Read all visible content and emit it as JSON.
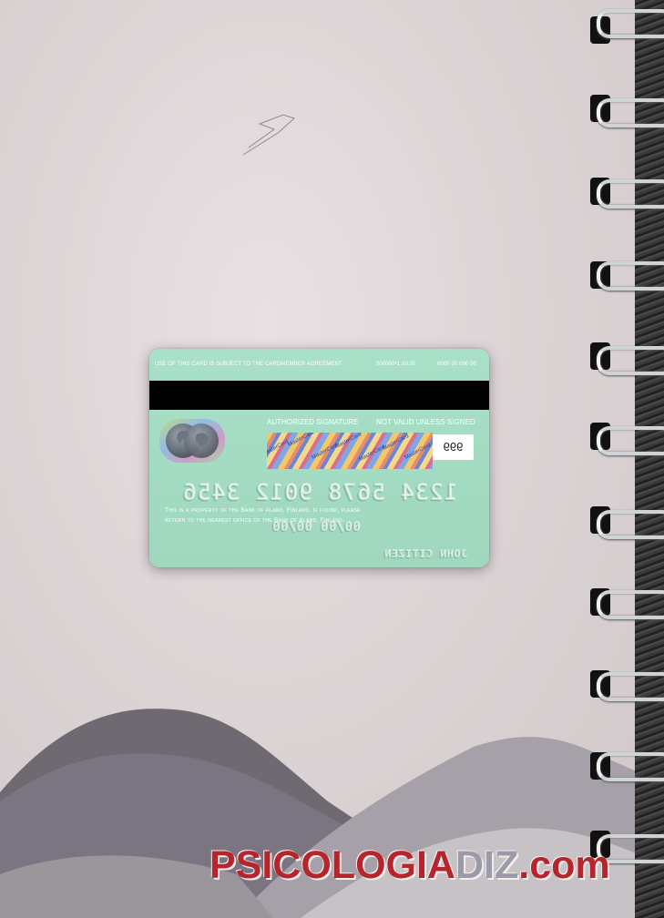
{
  "card": {
    "top_notice": "USE OF THIS CARD IS SUBJECT TO THE CARDMEMBER AGREEMENT",
    "top_code_1": "000000•1.00.00",
    "top_code_2": "0000 00 000 00",
    "authorized_signature": "AUTHORIZED SIGNATURE",
    "not_valid": "NOT VALID UNLESS SIGNED",
    "cvv": "999",
    "card_number": "1234 5678 9012 3456",
    "property_notice_line1": "This is a property of the Bank of Aland, Finland. If found, please",
    "property_notice_line2": "return to the nearest office of the Bank of Aland, Finland.",
    "dates": "00/00  00/00",
    "holder_name": "JOHN CITIZEN",
    "signature_strip_text": "MasterCard",
    "colors": {
      "card": "#a5dec4",
      "magstripe": "#000000"
    }
  },
  "watermark": {
    "part1": "PSICOLOGIA",
    "part2": "DIZ",
    "part3": ".com",
    "colors": {
      "main": "#b5252b",
      "accent": "#9a9aa8"
    }
  }
}
